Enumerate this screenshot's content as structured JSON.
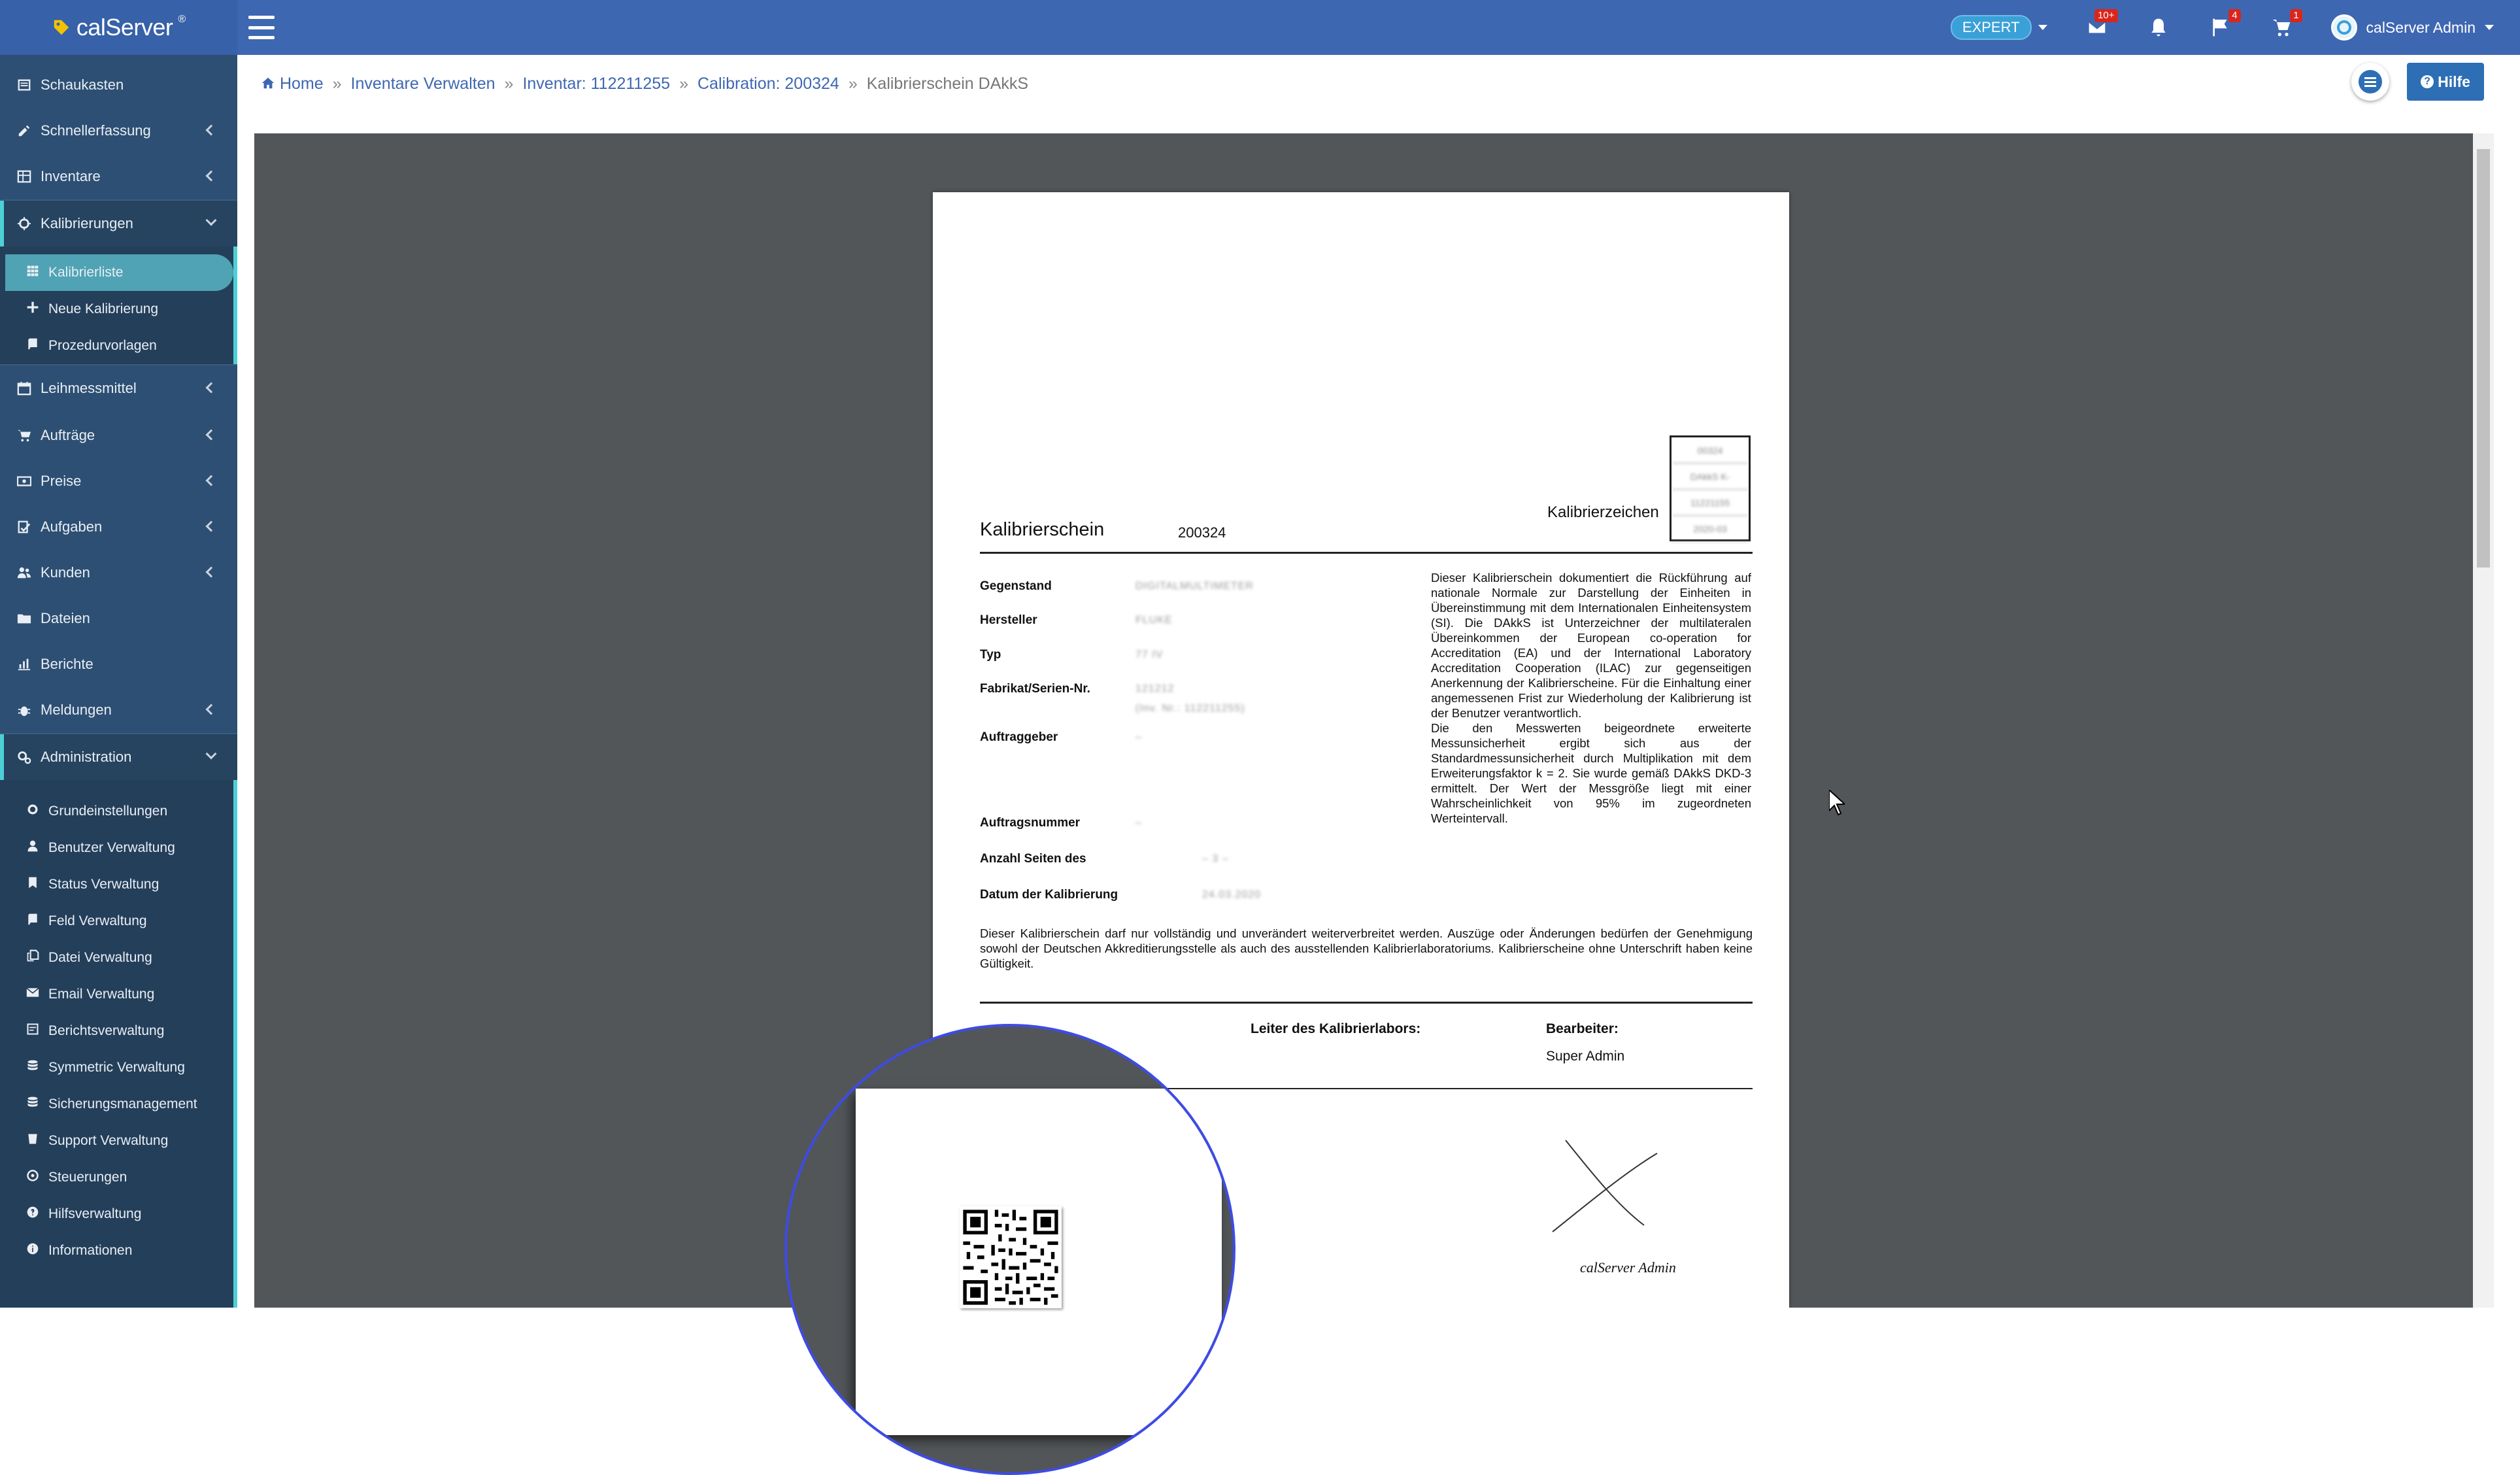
{
  "app": {
    "name": "calServer",
    "reg": "®"
  },
  "topbar": {
    "expert_label": "EXPERT",
    "mail_badge": "10+",
    "flag_badge": "4",
    "cart_badge": "1",
    "user_name": "calServer Admin"
  },
  "sidebar": {
    "items": [
      {
        "label": "Schaukasten"
      },
      {
        "label": "Schnellerfassung"
      },
      {
        "label": "Inventare"
      },
      {
        "label": "Kalibrierungen"
      },
      {
        "label": "Leihmessmittel"
      },
      {
        "label": "Aufträge"
      },
      {
        "label": "Preise"
      },
      {
        "label": "Aufgaben"
      },
      {
        "label": "Kunden"
      },
      {
        "label": "Dateien"
      },
      {
        "label": "Berichte"
      },
      {
        "label": "Meldungen"
      },
      {
        "label": "Administration"
      }
    ],
    "kalibrierungen_sub": [
      {
        "label": "Kalibrierliste"
      },
      {
        "label": "Neue Kalibrierung"
      },
      {
        "label": "Prozedurvorlagen"
      }
    ],
    "admin_sub": [
      {
        "label": "Grundeinstellungen"
      },
      {
        "label": "Benutzer Verwaltung"
      },
      {
        "label": "Status Verwaltung"
      },
      {
        "label": "Feld Verwaltung"
      },
      {
        "label": "Datei Verwaltung"
      },
      {
        "label": "Email Verwaltung"
      },
      {
        "label": "Berichtsverwaltung"
      },
      {
        "label": "Symmetric Verwaltung"
      },
      {
        "label": "Sicherungsmanagement"
      },
      {
        "label": "Support Verwaltung"
      },
      {
        "label": "Steuerungen"
      },
      {
        "label": "Hilfsverwaltung"
      },
      {
        "label": "Informationen"
      }
    ]
  },
  "breadcrumb": {
    "home": "Home",
    "b1": "Inventare Verwalten",
    "b2": "Inventar: 112211255",
    "b3": "Calibration: 200324",
    "current": "Kalibrierschein DAkkS",
    "sep": "»"
  },
  "help_label": "Hilfe",
  "document": {
    "title": "Kalibrierschein",
    "number": "200324",
    "kz_label": "Kalibrierzeichen",
    "kz_values": [
      "00324",
      "DAkkS K-",
      "11221155",
      "2020-03"
    ],
    "fields": [
      {
        "label": "Gegenstand",
        "value": "DIGITALMULTIMETER"
      },
      {
        "label": "Hersteller",
        "value": "FLUKE"
      },
      {
        "label": "Typ",
        "value": "77 IV"
      },
      {
        "label": "Fabrikat/Serien-Nr.",
        "value": "121212",
        "value2": "(Inv. Nr.: 112211255)"
      },
      {
        "label": "Auftraggeber",
        "value": "–"
      },
      {
        "label": "Auftragsnummer",
        "value": "–"
      },
      {
        "label": "Anzahl Seiten des",
        "value": "– 3 –"
      },
      {
        "label": "Datum der Kalibrierung",
        "value": "24.03.2020"
      }
    ],
    "description": "Dieser Kalibrierschein dokumentiert die Rückführung auf nationale Normale zur Darstellung der Einheiten in Übereinstimmung mit dem Internationalen Einheitensystem (SI). Die DAkkS ist Unterzeichner der multilateralen Übereinkommen der European co-operation for Accreditation (EA) und der International Laboratory Accreditation Cooperation (ILAC) zur gegenseitigen Anerkennung der Kalibrierscheine. Für die Einhaltung einer angemessenen Frist zur Wiederholung der Kalibrierung ist der Benutzer verantwortlich.",
    "description2": "Die den Messwerten beigeordnete erweiterte Messunsicherheit ergibt sich aus der Standardmessunsicherheit durch Multiplikation mit dem Erweiterungsfaktor k = 2. Sie wurde gemäß DAkkS DKD-3 ermittelt. Der Wert der Messgröße liegt mit einer Wahrscheinlichkeit von 95% im zugeordneten Werteintervall.",
    "notice": "Dieser Kalibrierschein darf nur vollständig und unverändert weiterverbreitet werden. Auszüge oder Änderungen bedürfen der Genehmigung sowohl der Deutschen Akkreditierungsstelle als auch des ausstellenden Kalibrierlaboratoriums. Kalibrierscheine ohne Unterschrift haben keine Gültigkeit.",
    "leiter_label": "Leiter des Kalibrierlabors:",
    "bearbeiter_label": "Bearbeiter:",
    "bearbeiter_name": "Super Admin",
    "signature_caption": "calServer Admin"
  }
}
